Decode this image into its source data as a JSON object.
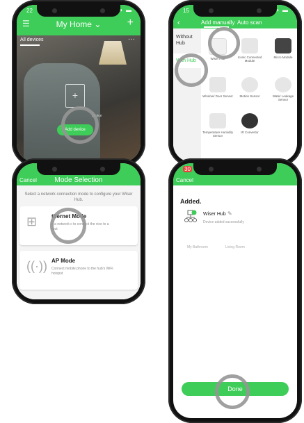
{
  "colors": {
    "accent": "#3dcd58",
    "highlight_ring": "#969696"
  },
  "phone1": {
    "status_time": "22",
    "title": "My Home",
    "title_caret": "⌄",
    "tab": "All devices",
    "more": "···",
    "hint": "device",
    "add_button": "Add device"
  },
  "phone2": {
    "status_time": "15",
    "back": "‹",
    "tabs": [
      "Add manually",
      "Auto scan"
    ],
    "categories": [
      "Without Hub",
      "With Hub"
    ],
    "devices": [
      "Wiser Hub",
      "Iconic Connected Module",
      "Micro Module",
      "Window/ Door Sensor",
      "Motion Sensor",
      "Water Leakage Sensor",
      "Temperature Humidity Sensor",
      "IR Convertor"
    ]
  },
  "phone3": {
    "cancel": "Cancel",
    "title": "Mode Selection",
    "lead": "Select a network connection mode to configure your Wiser Hub.",
    "modes": [
      {
        "title": "thernet Mode",
        "desc": "e a network c         to connect the         vice to a rout"
      },
      {
        "title": "AP Mode",
        "desc": "Connect mobile phone to the hub's WiFi hotspot"
      }
    ]
  },
  "phone4": {
    "status_time": "30",
    "cancel": "Cancel",
    "added": "Added.",
    "hub_name": "Wiser Hub",
    "hub_sub": "Device added successfully",
    "rooms": [
      "My Bathroom",
      "Living Room"
    ],
    "done": "Done"
  }
}
